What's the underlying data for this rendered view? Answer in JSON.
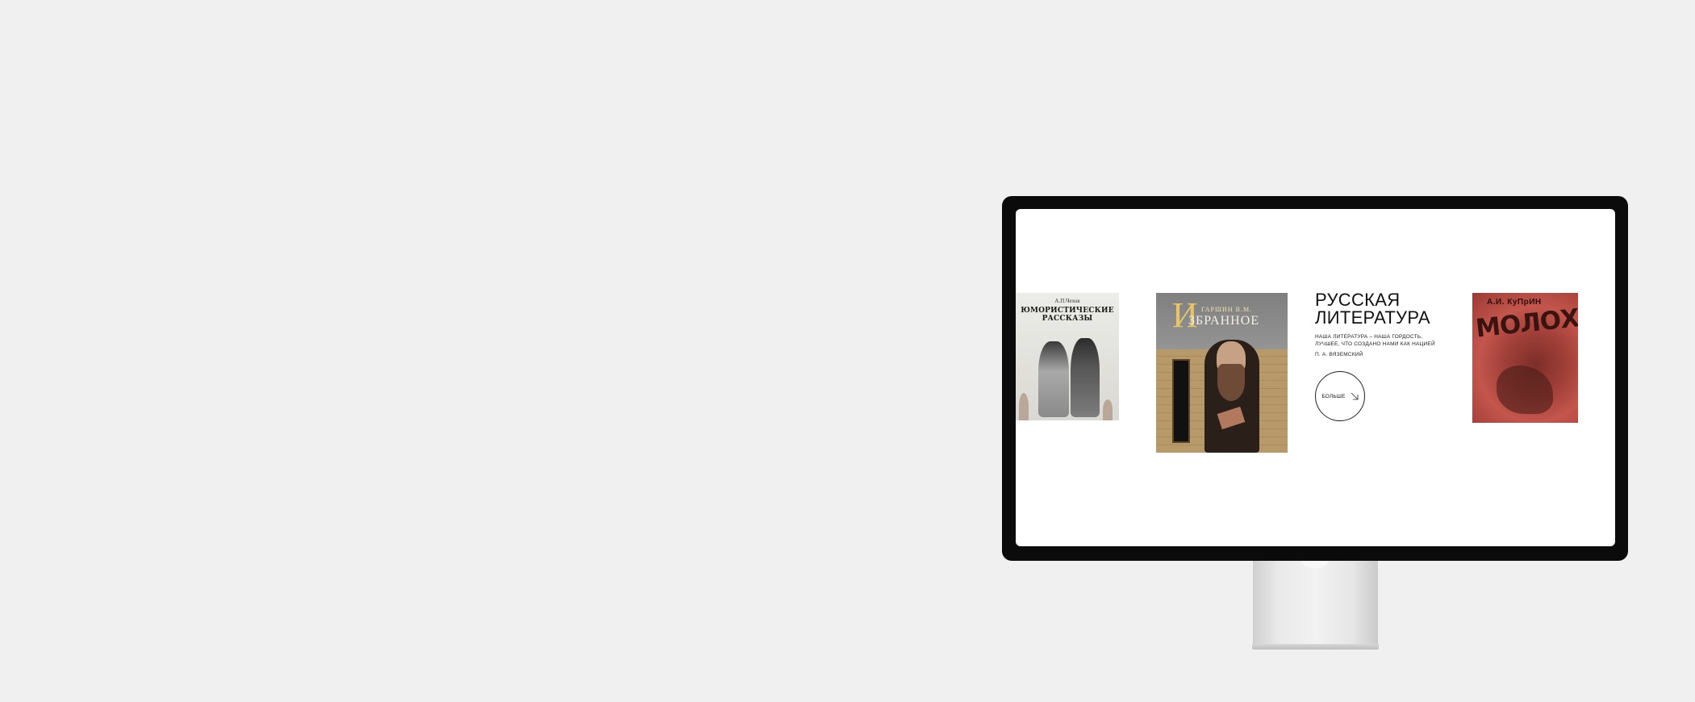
{
  "hero": {
    "title_line1": "РУССКАЯ",
    "title_line2": "ЛИТЕРАТУРА",
    "quote_line1": "НАША ЛИТЕРАТУРА – НАША ГОРДОСТЬ,",
    "quote_line2": "ЛУЧШЕЕ, ЧТО СОЗДАНО НАМИ КАК НАЦИЕЙ",
    "attribution": "П. А. ВЯЗЕМСКИЙ",
    "more_label": "БОЛЬШЕ",
    "more_icon": "arrow-down-right-icon"
  },
  "books": {
    "chekhov": {
      "author": "А.П.Чехов",
      "title_line1": "ЮМОРИСТИЧЕСКИЕ",
      "title_line2": "РАССКАЗЫ"
    },
    "garshin": {
      "initial": "И",
      "author": "ГАРШИН В.М.",
      "title": "ЗБРАННОЕ"
    },
    "kuprin": {
      "author": "А.И. КуПрИН",
      "title": "МОЛОХ"
    }
  },
  "colors": {
    "page_background": "#f0f0f0",
    "bezel": "#0b0b0b",
    "screen": "#ffffff",
    "text": "#111111"
  }
}
